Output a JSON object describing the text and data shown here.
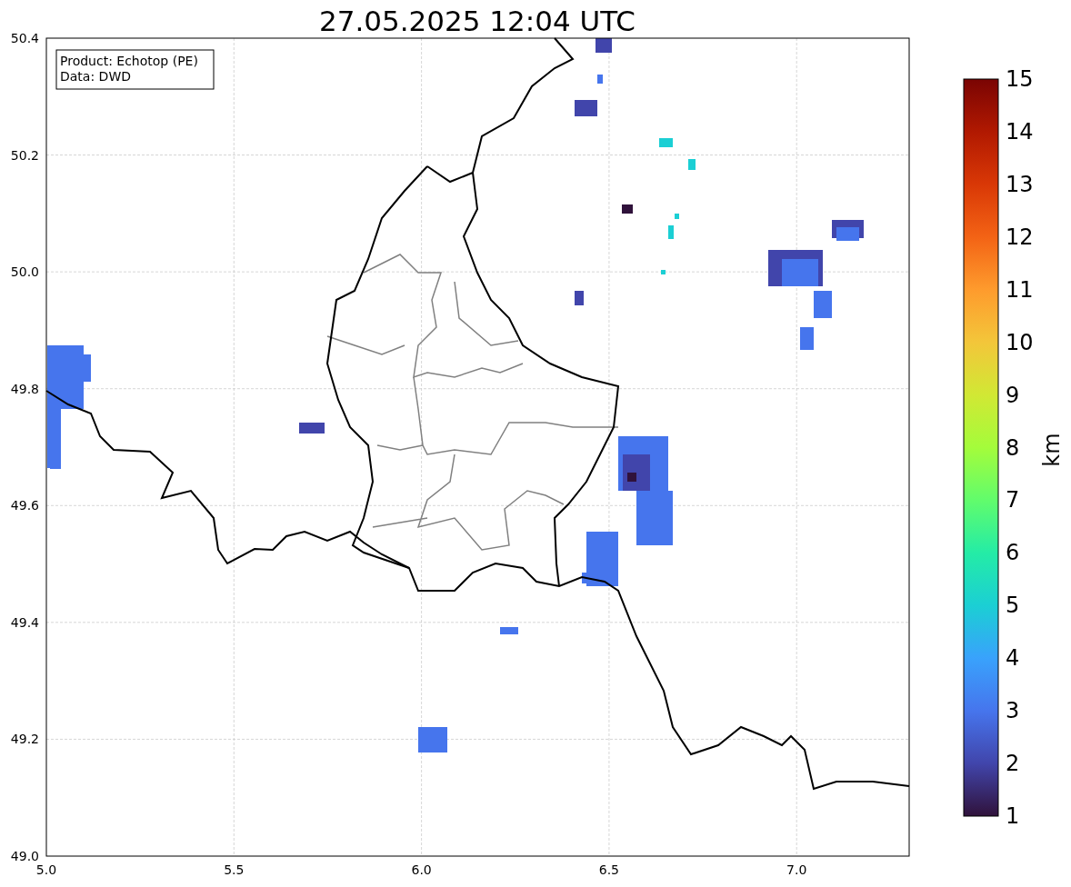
{
  "title": "27.05.2025 12:04 UTC",
  "legend": [
    "Product: Echotop (PE)",
    "Data: DWD"
  ],
  "x_axis": {
    "ticks": [
      "5.0",
      "5.5",
      "6.0",
      "6.5",
      "7.0"
    ]
  },
  "y_axis": {
    "ticks": [
      "50.4",
      "50.2",
      "50.0",
      "49.8",
      "49.6",
      "49.4",
      "49.2",
      "49.0"
    ]
  },
  "colorbar": {
    "label": "km",
    "ticks": [
      "15",
      "14",
      "13",
      "12",
      "11",
      "10",
      "9",
      "8",
      "7",
      "6",
      "5",
      "4",
      "3",
      "2",
      "1"
    ]
  }
}
